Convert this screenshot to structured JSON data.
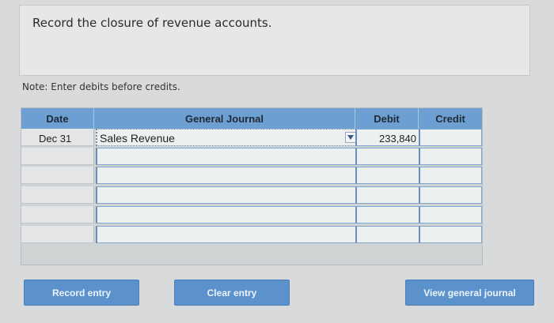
{
  "prompt": {
    "text": "Record the closure of revenue accounts."
  },
  "note": "Note: Enter debits before credits.",
  "journal": {
    "headers": {
      "date": "Date",
      "general_journal": "General Journal",
      "debit": "Debit",
      "credit": "Credit"
    },
    "rows": [
      {
        "date": "Dec 31",
        "account": "Sales Revenue",
        "debit": "233,840",
        "credit": ""
      },
      {
        "date": "",
        "account": "",
        "debit": "",
        "credit": ""
      },
      {
        "date": "",
        "account": "",
        "debit": "",
        "credit": ""
      },
      {
        "date": "",
        "account": "",
        "debit": "",
        "credit": ""
      },
      {
        "date": "",
        "account": "",
        "debit": "",
        "credit": ""
      },
      {
        "date": "",
        "account": "",
        "debit": "",
        "credit": ""
      }
    ]
  },
  "buttons": {
    "record": "Record entry",
    "clear": "Clear entry",
    "view": "View general journal"
  },
  "colors": {
    "header": "#6e9fd3",
    "button": "#5b92cc"
  }
}
